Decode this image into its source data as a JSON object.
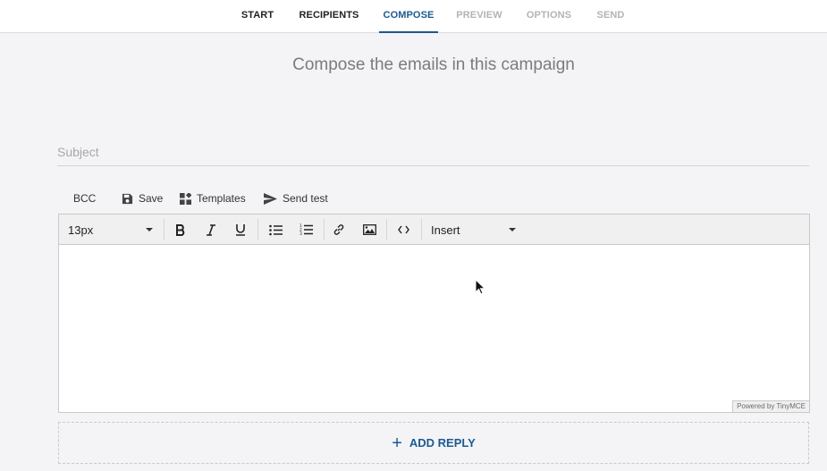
{
  "steps": [
    {
      "label": "START",
      "state": "done"
    },
    {
      "label": "RECIPIENTS",
      "state": "done"
    },
    {
      "label": "COMPOSE",
      "state": "active"
    },
    {
      "label": "PREVIEW",
      "state": "disabled"
    },
    {
      "label": "OPTIONS",
      "state": "disabled"
    },
    {
      "label": "SEND",
      "state": "disabled"
    }
  ],
  "page_title": "Compose the emails in this campaign",
  "subject": {
    "placeholder": "Subject",
    "value": ""
  },
  "actions": {
    "bcc": "BCC",
    "save": "Save",
    "templates": "Templates",
    "send_test": "Send test"
  },
  "toolbar": {
    "font_size": "13px",
    "insert": "Insert",
    "icons": [
      "bold-icon",
      "italic-icon",
      "underline-icon",
      "bullet-list-icon",
      "numbered-list-icon",
      "link-icon",
      "image-icon",
      "code-icon"
    ]
  },
  "powered_by": "Powered by TinyMCE",
  "add_reply": {
    "label": "ADD REPLY",
    "icon": "plus-icon"
  },
  "colors": {
    "accent": "#1d5a91",
    "disabled": "#b4b4b8",
    "background": "#f4f4f6"
  }
}
